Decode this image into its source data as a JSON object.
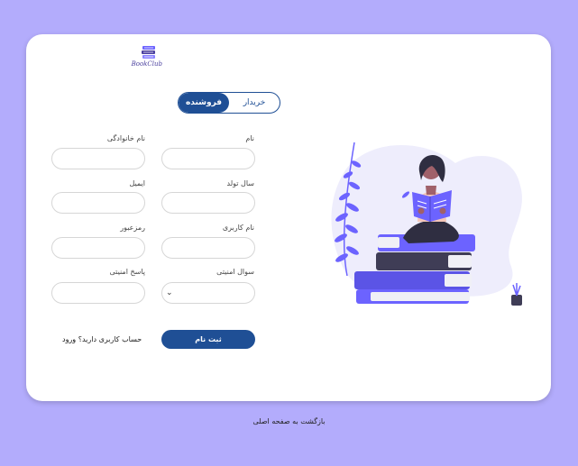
{
  "logo": {
    "text": "BookClub",
    "icon": "book-stack-icon"
  },
  "toggle": {
    "seller_label": "فروشنده",
    "buyer_label": "خریدار",
    "selected": "seller"
  },
  "form": {
    "first_name": {
      "label": "نام",
      "value": ""
    },
    "last_name": {
      "label": "نام خانوادگی",
      "value": ""
    },
    "birth_year": {
      "label": "سال تولد",
      "value": ""
    },
    "email": {
      "label": "ایمیل",
      "value": ""
    },
    "username": {
      "label": "نام کاربری",
      "value": ""
    },
    "password": {
      "label": "رمزعبور",
      "value": ""
    },
    "security_question": {
      "label": "سوال امنیتی",
      "value": ""
    },
    "security_answer": {
      "label": "پاسخ امنیتی",
      "value": ""
    }
  },
  "submit_label": "ثبت نام",
  "login_prompt": {
    "question": "حساب کاربری دارید؟",
    "link": "ورود"
  },
  "back_link": "بازگشت به صفحه اصلی",
  "colors": {
    "background": "#b3acfc",
    "primary": "#1f4f95",
    "accent": "#6c63ff"
  },
  "illustration": "woman-reading-on-books-illustration"
}
